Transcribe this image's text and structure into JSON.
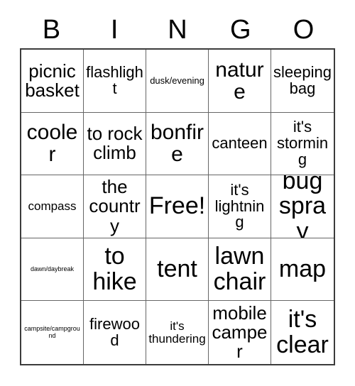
{
  "card": {
    "title_letters": [
      "B",
      "I",
      "N",
      "G",
      "O"
    ],
    "rows": [
      [
        {
          "text": "picnic basket",
          "size": "lg"
        },
        {
          "text": "flashlight",
          "size": "md"
        },
        {
          "text": "dusk/evening",
          "size": "xs"
        },
        {
          "text": "nature",
          "size": "xl"
        },
        {
          "text": "sleeping bag",
          "size": "md"
        }
      ],
      [
        {
          "text": "cooler",
          "size": "xl"
        },
        {
          "text": "to rock climb",
          "size": "lg"
        },
        {
          "text": "bonfire",
          "size": "xl"
        },
        {
          "text": "canteen",
          "size": "md"
        },
        {
          "text": "it's storming",
          "size": "md"
        }
      ],
      [
        {
          "text": "compass",
          "size": "sm"
        },
        {
          "text": "the country",
          "size": "lg"
        },
        {
          "text": "Free!",
          "size": "xxl"
        },
        {
          "text": "it's lightning",
          "size": "md"
        },
        {
          "text": "bug spray",
          "size": "xxl"
        }
      ],
      [
        {
          "text": "dawn/daybreak",
          "size": "xxs"
        },
        {
          "text": "to hike",
          "size": "xxl"
        },
        {
          "text": "tent",
          "size": "xxl"
        },
        {
          "text": "lawn chair",
          "size": "xxl"
        },
        {
          "text": "map",
          "size": "xxl"
        }
      ],
      [
        {
          "text": "campsite/campground",
          "size": "xxs"
        },
        {
          "text": "firewood",
          "size": "md"
        },
        {
          "text": "it's thundering",
          "size": "sm"
        },
        {
          "text": "mobile camper",
          "size": "lg"
        },
        {
          "text": "it's clear",
          "size": "xxl"
        }
      ]
    ],
    "colors": {
      "background": "#ffffff",
      "text": "#000000",
      "grid_line": "#666666",
      "grid_outer": "#3c3c3c"
    }
  }
}
